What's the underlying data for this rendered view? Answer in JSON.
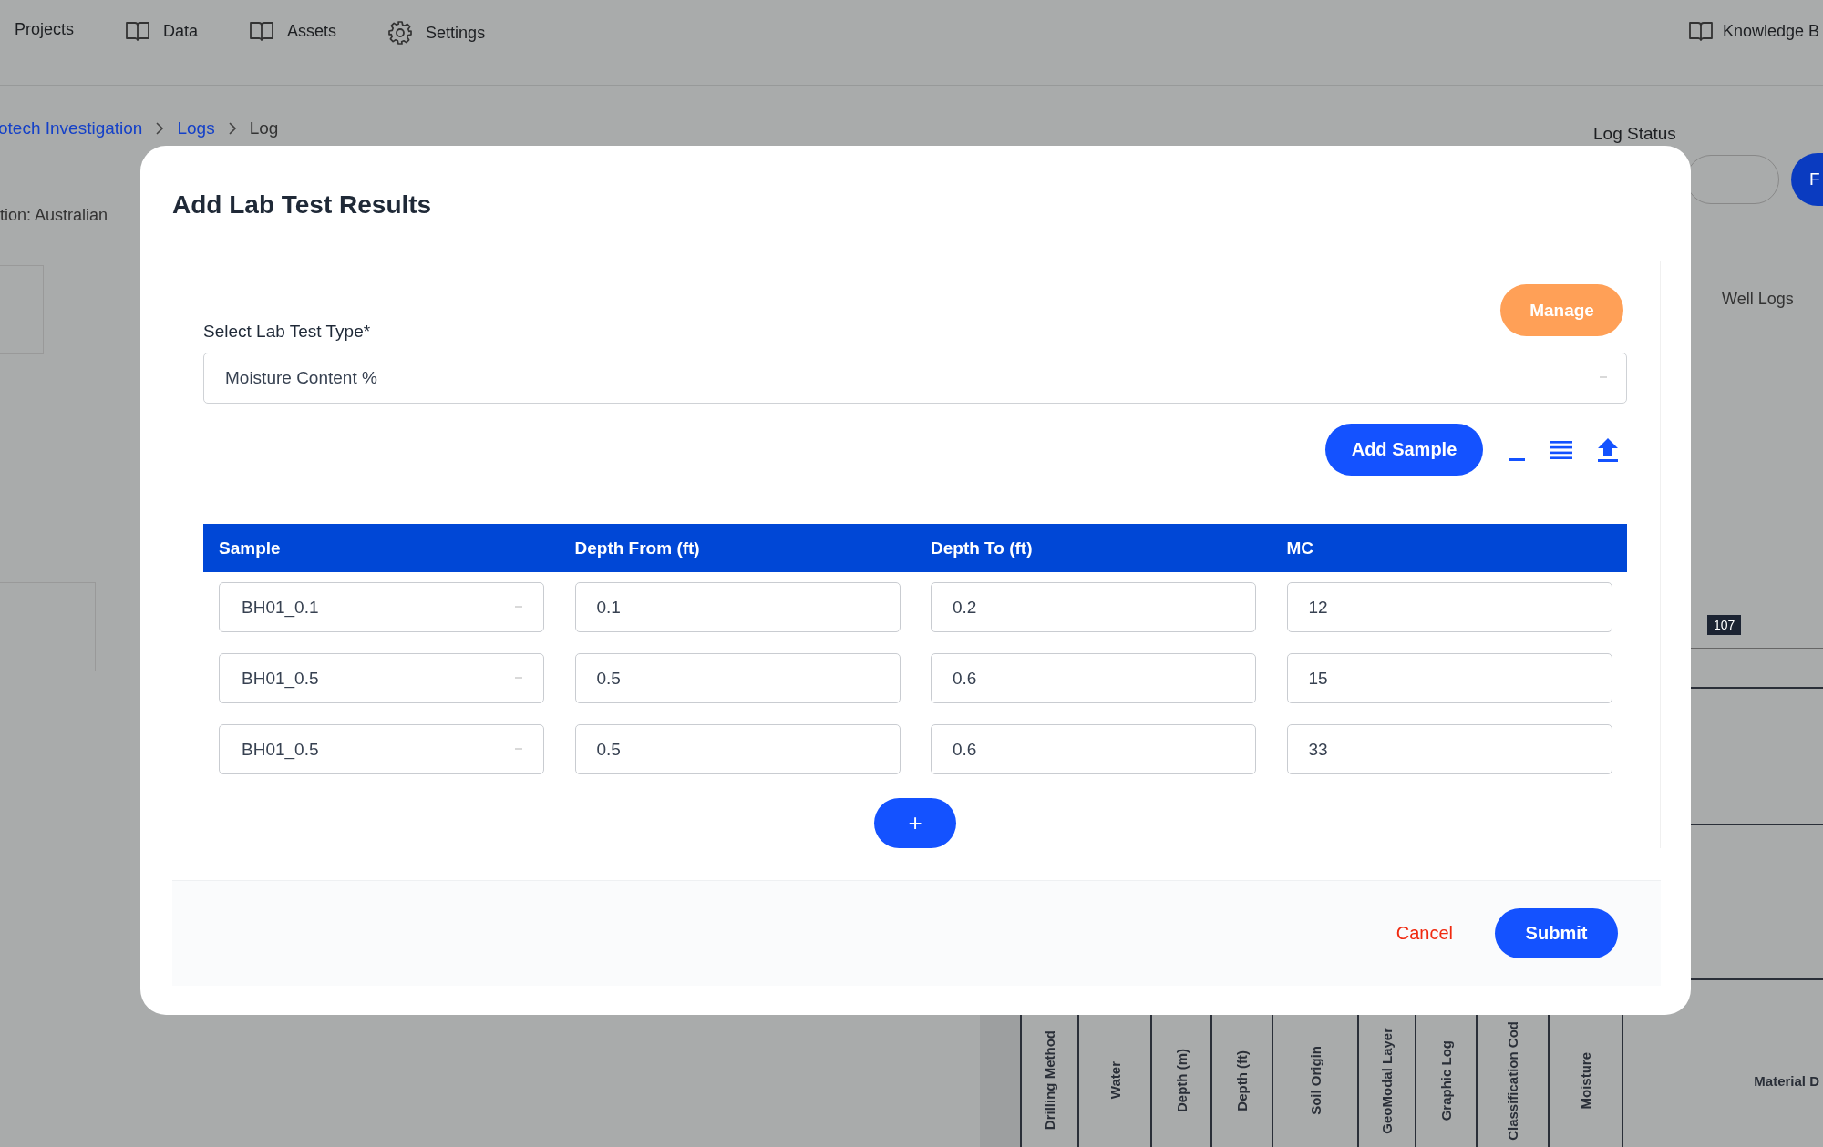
{
  "nav": {
    "items": [
      {
        "label": "Projects"
      },
      {
        "label": "Data"
      },
      {
        "label": "Assets"
      },
      {
        "label": "Settings"
      }
    ],
    "right": {
      "label": "Knowledge B"
    }
  },
  "breadcrumb": [
    {
      "label": "otech Investigation",
      "link": true
    },
    {
      "label": "Logs",
      "link": true
    },
    {
      "label": "Log",
      "link": false
    }
  ],
  "background": {
    "location_text": "tion: Australian",
    "log_status_label": "Log Status",
    "action_button": "F",
    "well_logs": "Well Logs",
    "depth_marker": "107",
    "log_columns": [
      "Drilling Method",
      "Water",
      "Depth (m)",
      "Depth (ft)",
      "Soil Origin",
      "GeoModal Layer",
      "Graphic Log",
      "Classification Cod",
      "Moisture"
    ],
    "material_label": "Material D"
  },
  "dialog": {
    "title": "Add Lab Test Results",
    "manage_button": "Manage",
    "test_type": {
      "label": "Select Lab Test Type*",
      "value": "Moisture Content %"
    },
    "add_sample_button": "Add Sample",
    "table": {
      "columns": [
        "Sample",
        "Depth From (ft)",
        "Depth To (ft)",
        "MC"
      ],
      "rows": [
        [
          "BH01_0.1",
          "0.1",
          "0.2",
          "12"
        ],
        [
          "BH01_0.5",
          "0.5",
          "0.6",
          "15"
        ],
        [
          "BH01_0.5",
          "0.5",
          "0.6",
          "33"
        ]
      ]
    },
    "add_row_button": "+",
    "cancel_button": "Cancel",
    "submit_button": "Submit"
  }
}
